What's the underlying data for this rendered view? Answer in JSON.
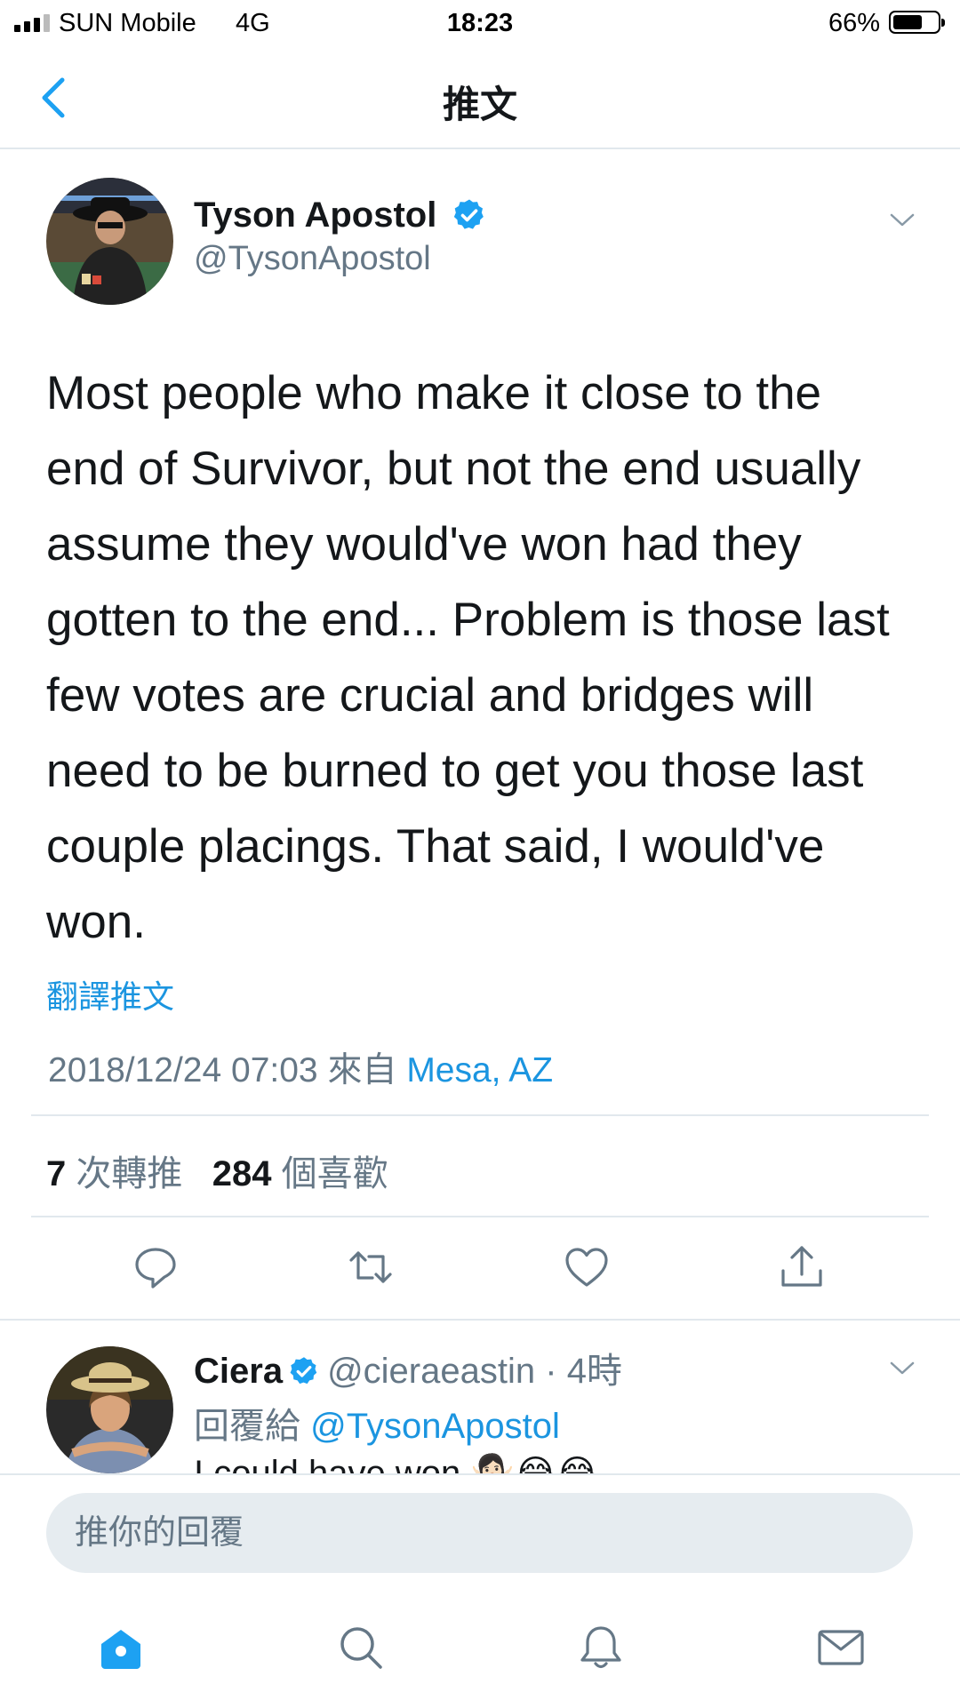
{
  "status_bar": {
    "carrier": "SUN Mobile",
    "network": "4G",
    "time": "18:23",
    "battery": "66%",
    "battery_level": 0.66
  },
  "nav": {
    "back_icon": "chevron-left-icon",
    "title": "推文"
  },
  "tweet": {
    "author_name": "Tyson Apostol",
    "author_handle": "@TysonApostol",
    "verified_icon": "verified-badge-icon",
    "menu_icon": "chevron-down-icon",
    "text_lines": [
      "Most people who make it close to the",
      "end of Survivor, but not the end usually",
      "assume they would've won had they",
      "gotten to the end... Problem is those last",
      "few votes are crucial and bridges will",
      "need to be burned to get you those last",
      "couple placings. That said, I would've",
      "won."
    ],
    "translate": "翻譯推文",
    "timestamp": "2018/12/24 07:03 來自",
    "location": "Mesa, AZ",
    "retweets_count": "7",
    "retweets_label": "次轉推",
    "likes_count": "284",
    "likes_label": "個喜歡",
    "actions": [
      "reply-icon",
      "retweet-icon",
      "like-icon",
      "share-icon"
    ]
  },
  "reply": {
    "name": "Ciera",
    "handle": "@cieraeastin",
    "separator": "·",
    "time": "4時",
    "replying_prefix": "回覆給",
    "replying_to": "@TysonApostol",
    "text": "I could have won 🤷🏻‍♀️😂😂"
  },
  "composer": {
    "placeholder": "推你的回覆"
  },
  "tab_bar": [
    "home-icon",
    "search-icon",
    "notifications-icon",
    "messages-icon"
  ],
  "colors": {
    "accent": "#1da1f2",
    "link": "#1b95e0",
    "secondary_text": "#657786",
    "divider": "#e1e8ed"
  }
}
